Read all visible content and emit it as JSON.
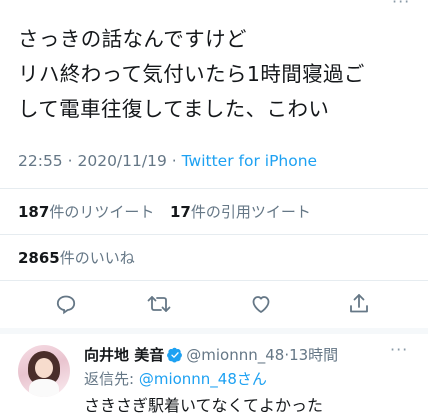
{
  "tweet": {
    "lines": [
      "さっきの話なんですけど",
      "リハ終わって気付いたら1時間寝過ご",
      "して電車往復してました、こわい"
    ],
    "time": "22:55",
    "date": "2020/11/19",
    "separator": "·",
    "client": "Twitter for iPhone"
  },
  "stats": {
    "retweets_count": "187",
    "retweets_label": "件のリツイート",
    "quotes_count": "17",
    "quotes_label": "件の引用ツイート",
    "likes_count": "2865",
    "likes_label": "件のいいね"
  },
  "actions": {
    "icons": [
      "reply-icon",
      "retweet-icon",
      "like-icon",
      "share-icon"
    ]
  },
  "reply": {
    "display_name": "向井地 美音",
    "handle": "@mionnn_48",
    "separator": "·",
    "time": "13時間",
    "reply_to_prefix": "返信先: ",
    "reply_to_handle": "@mionnn_48さん",
    "text": "さきさぎ駅着いてなくてよかった"
  },
  "colors": {
    "accent": "#1da1f2",
    "muted": "#657786",
    "divider": "#e6ecf0"
  }
}
